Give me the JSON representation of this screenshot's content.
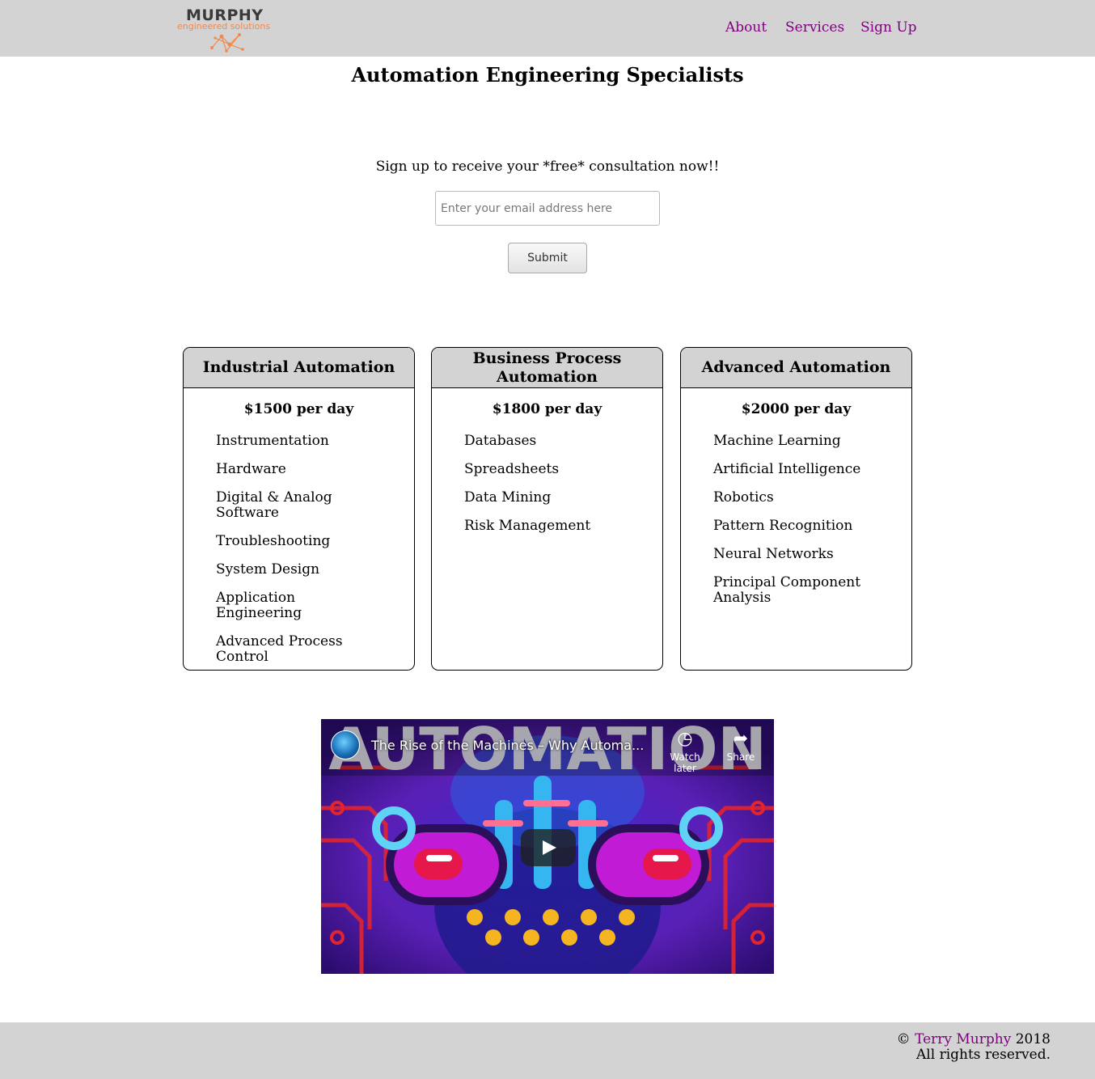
{
  "header": {
    "logo_title": "MURPHY",
    "logo_subtitle": "engineered solutions",
    "nav": {
      "about": "About",
      "services": "Services",
      "signup": "Sign Up"
    }
  },
  "main_title": "Automation Engineering Specialists",
  "signup": {
    "text": "Sign up to receive your *free* consultation now!!",
    "email_placeholder": "Enter your email address here",
    "submit_label": "Submit"
  },
  "cards": [
    {
      "title": "Industrial Automation",
      "price": "$1500 per day",
      "items": [
        "Instrumentation",
        "Hardware",
        "Digital & Analog Software",
        "Troubleshooting",
        "System Design",
        "Application Engineering",
        "Advanced Process Control"
      ]
    },
    {
      "title": "Business Process Automation",
      "price": "$1800 per day",
      "items": [
        "Databases",
        "Spreadsheets",
        "Data Mining",
        "Risk Management"
      ]
    },
    {
      "title": "Advanced Automation",
      "price": "$2000 per day",
      "items": [
        "Machine Learning",
        "Artificial Intelligence",
        "Robotics",
        "Pattern Recognition",
        "Neural Networks",
        "Principal Component Analysis"
      ]
    }
  ],
  "video": {
    "title": "The Rise of the Machines – Why Automa...",
    "thumbnail_text": "AUTOMATION",
    "watch_later": "Watch later",
    "share": "Share"
  },
  "footer": {
    "copyright_symbol": "©",
    "author": "Terry Murphy",
    "year": "2018",
    "rights": "All rights reserved."
  },
  "colors": {
    "bar_background": "#d3d3d3",
    "link": "#800080",
    "logo_accent": "#f08a4b"
  }
}
